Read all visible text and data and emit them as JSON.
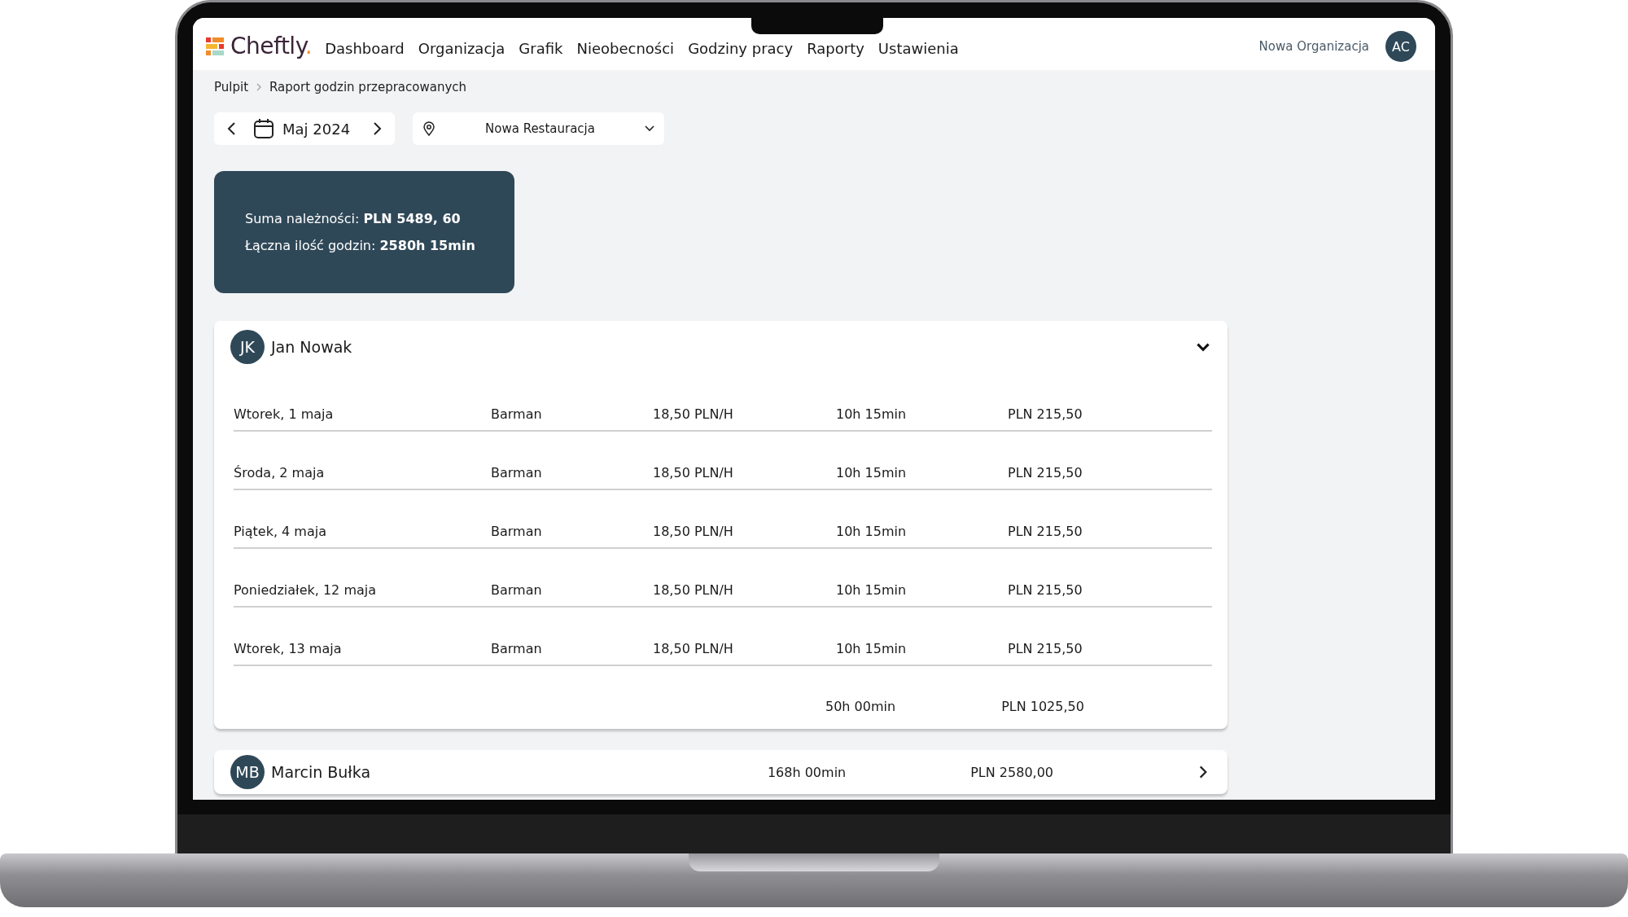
{
  "nav": {
    "logo": "Cheftly",
    "logo_dot": ".",
    "items": [
      {
        "label": "Dashboard",
        "selected": false
      },
      {
        "label": "Organizacja",
        "selected": false
      },
      {
        "label": "Grafik",
        "selected": false
      },
      {
        "label": "Nieobecności",
        "selected": false
      },
      {
        "label": "Godziny pracy",
        "selected": false
      },
      {
        "label": "Raporty",
        "selected": false
      },
      {
        "label": "Ustawienia",
        "selected": false
      }
    ],
    "organization": "Nowa Organizacja",
    "avatar": "AC"
  },
  "breadcrumb": [
    "Pulpit",
    "Raport godzin przepracowanych"
  ],
  "period": "Maj 2024",
  "location": "Nowa Restauracja",
  "summary": [
    "Suma należności: **PLN 5489, 60**",
    "Łączna ilość godzin: **2580h 15min**"
  ],
  "employees": [
    {
      "initials": "JK",
      "name": "Jan Nowak",
      "expanded": true,
      "rows": [
        {
          "day": "Wtorek, 1 maja",
          "role": "Barman",
          "rate": "18,50 PLN/H",
          "hours": "10h 15min",
          "amount": "PLN 215,50"
        },
        {
          "day": "Środa, 2 maja",
          "role": "Barman",
          "rate": "18,50 PLN/H",
          "hours": "10h 15min",
          "amount": "PLN 215,50"
        },
        {
          "day": "Piątek, 4 maja",
          "role": "Barman",
          "rate": "18,50 PLN/H",
          "hours": "10h 15min",
          "amount": "PLN 215,50"
        },
        {
          "day": "Poniedziałek, 12 maja",
          "role": "Barman",
          "rate": "18,50 PLN/H",
          "hours": "10h 15min",
          "amount": "PLN 215,50"
        },
        {
          "day": "Wtorek, 13 maja",
          "role": "Barman",
          "rate": "18,50 PLN/H",
          "hours": "10h 15min",
          "amount": "PLN 215,50"
        }
      ],
      "total_hours": "50h 00min",
      "total_amount": "PLN 1025,50"
    },
    {
      "initials": "MB",
      "name": "Marcin Bułka",
      "expanded": false,
      "total_hours": "168h 00min",
      "total_amount": "PLN 2580,00"
    }
  ]
}
